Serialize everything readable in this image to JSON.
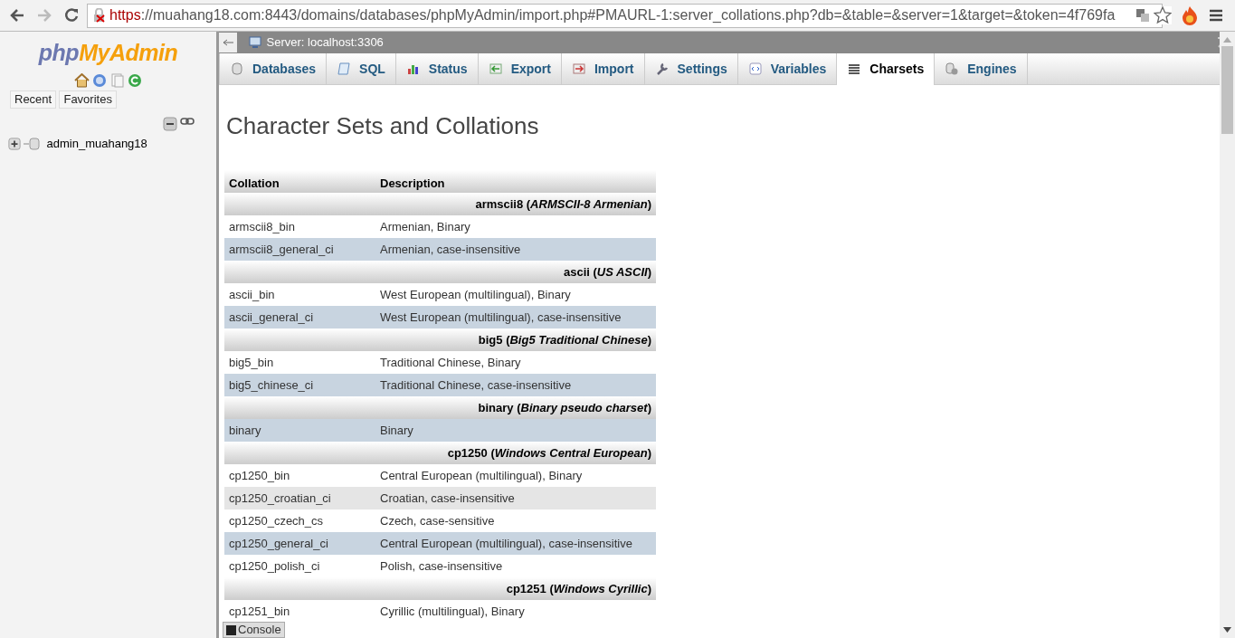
{
  "browser": {
    "url_scheme": "https",
    "url_rest": "://muahang18.com:8443/domains/databases/phpMyAdmin/import.php#PMAURL-1:server_collations.php?db=&table=&server=1&target=&token=4f769fa"
  },
  "sidebar": {
    "logo_left": "php",
    "logo_right": "MyAdmin",
    "buttons": [
      "Recent",
      "Favorites"
    ],
    "databases": [
      {
        "name": "admin_muahang18",
        "expanded": false
      }
    ]
  },
  "server_bar": {
    "title": "Server: localhost:3306"
  },
  "tabs": [
    {
      "label": "Databases",
      "selected": false
    },
    {
      "label": "SQL",
      "selected": false
    },
    {
      "label": "Status",
      "selected": false
    },
    {
      "label": "Export",
      "selected": false
    },
    {
      "label": "Import",
      "selected": false
    },
    {
      "label": "Settings",
      "selected": false
    },
    {
      "label": "Variables",
      "selected": false
    },
    {
      "label": "Charsets",
      "selected": true
    },
    {
      "label": "Engines",
      "selected": false
    }
  ],
  "heading": "Character Sets and Collations",
  "table": {
    "columns": [
      "Collation",
      "Description"
    ],
    "rows": [
      {
        "kind": "group",
        "text": "armscii8 (*ARMSCII-8 Armenian*)"
      },
      {
        "kind": "row",
        "collation": "armscii8_bin",
        "description": "Armenian, Binary",
        "highlighted": false
      },
      {
        "kind": "row",
        "collation": "armscii8_general_ci",
        "description": "Armenian, case-insensitive",
        "highlighted": true
      },
      {
        "kind": "group",
        "text": "ascii (*US ASCII*)"
      },
      {
        "kind": "row",
        "collation": "ascii_bin",
        "description": "West European (multilingual), Binary",
        "highlighted": false
      },
      {
        "kind": "row",
        "collation": "ascii_general_ci",
        "description": "West European (multilingual), case-insensitive",
        "highlighted": true
      },
      {
        "kind": "group",
        "text": "big5 (*Big5 Traditional Chinese*)"
      },
      {
        "kind": "row",
        "collation": "big5_bin",
        "description": "Traditional Chinese, Binary",
        "highlighted": false
      },
      {
        "kind": "row",
        "collation": "big5_chinese_ci",
        "description": "Traditional Chinese, case-insensitive",
        "highlighted": true
      },
      {
        "kind": "group",
        "text": "binary (*Binary pseudo charset*)"
      },
      {
        "kind": "row",
        "collation": "binary",
        "description": "Binary",
        "highlighted": true
      },
      {
        "kind": "group",
        "text": "cp1250 (*Windows Central European*)"
      },
      {
        "kind": "row",
        "collation": "cp1250_bin",
        "description": "Central European (multilingual), Binary",
        "highlighted": false
      },
      {
        "kind": "row",
        "collation": "cp1250_croatian_ci",
        "description": "Croatian, case-insensitive",
        "highlighted": false
      },
      {
        "kind": "row",
        "collation": "cp1250_czech_cs",
        "description": "Czech, case-sensitive",
        "highlighted": false
      },
      {
        "kind": "row",
        "collation": "cp1250_general_ci",
        "description": "Central European (multilingual), case-insensitive",
        "highlighted": true
      },
      {
        "kind": "row",
        "collation": "cp1250_polish_ci",
        "description": "Polish, case-insensitive",
        "highlighted": false
      },
      {
        "kind": "group",
        "text": "cp1251 (*Windows Cyrillic*)"
      },
      {
        "kind": "row",
        "collation": "cp1251_bin",
        "description": "Cyrillic (multilingual), Binary",
        "highlighted": false
      }
    ]
  },
  "console": {
    "label": "Console"
  }
}
